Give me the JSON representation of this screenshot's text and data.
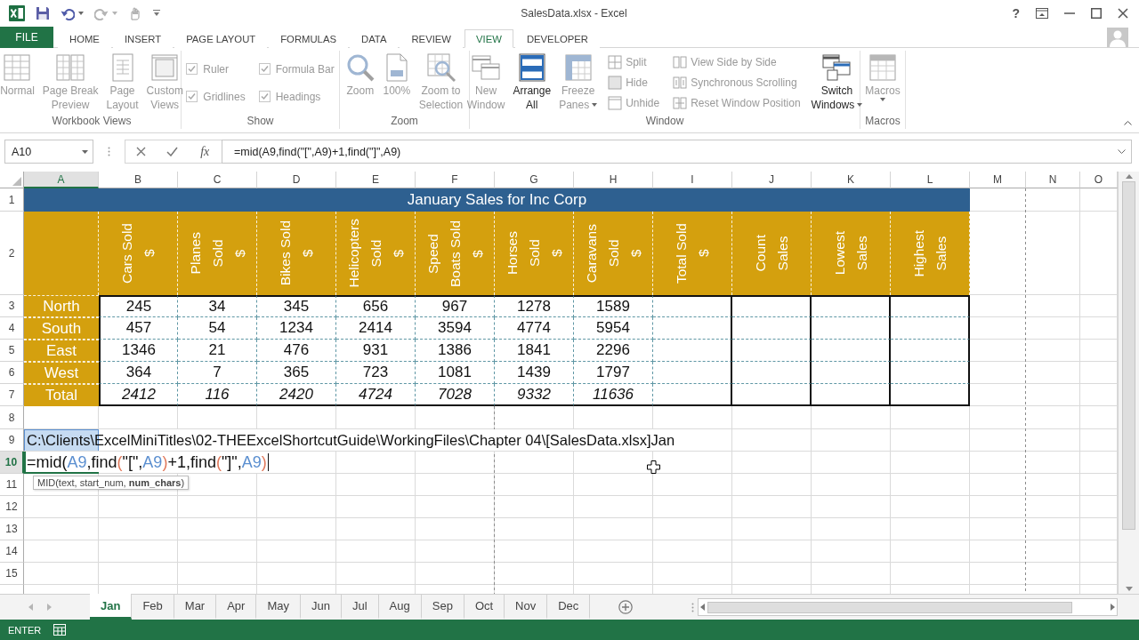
{
  "window": {
    "title": "SalesData.xlsx - Excel",
    "help": "?"
  },
  "ribbon_tabs": [
    {
      "label": "FILE",
      "kind": "file",
      "selected": false
    },
    {
      "label": "HOME",
      "kind": "tab",
      "selected": false
    },
    {
      "label": "INSERT",
      "kind": "tab",
      "selected": false
    },
    {
      "label": "PAGE LAYOUT",
      "kind": "tab",
      "selected": false
    },
    {
      "label": "FORMULAS",
      "kind": "tab",
      "selected": false
    },
    {
      "label": "DATA",
      "kind": "tab",
      "selected": false
    },
    {
      "label": "REVIEW",
      "kind": "tab",
      "selected": false
    },
    {
      "label": "VIEW",
      "kind": "tab",
      "selected": true
    },
    {
      "label": "DEVELOPER",
      "kind": "tab",
      "selected": false
    }
  ],
  "ribbon": {
    "groups": [
      {
        "title": "Workbook Views",
        "items": [
          {
            "kind": "large",
            "lines": [
              "Normal"
            ],
            "disabled": true,
            "dropdown": false
          },
          {
            "kind": "large",
            "lines": [
              "Page Break",
              "Preview"
            ],
            "disabled": true,
            "dropdown": false
          },
          {
            "kind": "large",
            "lines": [
              "Page",
              "Layout"
            ],
            "disabled": true,
            "dropdown": false
          },
          {
            "kind": "large",
            "lines": [
              "Custom",
              "Views"
            ],
            "disabled": true,
            "dropdown": false
          }
        ]
      },
      {
        "title": "Show",
        "items": [
          {
            "kind": "checkbox",
            "label": "Ruler",
            "checked": true,
            "disabled": true
          },
          {
            "kind": "checkbox",
            "label": "Gridlines",
            "checked": true,
            "disabled": true
          },
          {
            "kind": "checkbox",
            "label": "Formula Bar",
            "checked": true,
            "disabled": true
          },
          {
            "kind": "checkbox",
            "label": "Headings",
            "checked": true,
            "disabled": true
          }
        ]
      },
      {
        "title": "Zoom",
        "items": [
          {
            "kind": "large",
            "lines": [
              "Zoom"
            ],
            "disabled": true,
            "dropdown": false
          },
          {
            "kind": "large",
            "lines": [
              "100%"
            ],
            "disabled": true,
            "dropdown": false
          },
          {
            "kind": "large",
            "lines": [
              "Zoom to",
              "Selection"
            ],
            "disabled": true,
            "dropdown": false
          }
        ]
      },
      {
        "title": "Window",
        "items": [
          {
            "kind": "large",
            "lines": [
              "New",
              "Window"
            ],
            "disabled": true,
            "dropdown": false
          },
          {
            "kind": "large",
            "lines": [
              "Arrange",
              "All"
            ],
            "disabled": false,
            "dropdown": false
          },
          {
            "kind": "large",
            "lines": [
              "Freeze",
              "Panes"
            ],
            "disabled": true,
            "dropdown": true
          },
          {
            "kind": "small",
            "label": "Split",
            "disabled": true
          },
          {
            "kind": "small",
            "label": "Hide",
            "disabled": true
          },
          {
            "kind": "small",
            "label": "Unhide",
            "disabled": true
          },
          {
            "kind": "small",
            "label": "View Side by Side",
            "disabled": true
          },
          {
            "kind": "small",
            "label": "Synchronous Scrolling",
            "disabled": true
          },
          {
            "kind": "small",
            "label": "Reset Window Position",
            "disabled": true
          },
          {
            "kind": "large",
            "lines": [
              "Switch",
              "Windows"
            ],
            "disabled": false,
            "dropdown": true
          }
        ]
      },
      {
        "title": "Macros",
        "items": [
          {
            "kind": "large",
            "lines": [
              "Macros"
            ],
            "disabled": true,
            "dropdown": true
          }
        ]
      }
    ]
  },
  "formula_bar": {
    "name_box": "A10",
    "function_label": "fx",
    "formula": "=mid(A9,find(\"[\",A9)+1,find(\"]\",A9)"
  },
  "columns": [
    {
      "label": "A",
      "selected": true
    },
    {
      "label": "B",
      "selected": false
    },
    {
      "label": "C",
      "selected": false
    },
    {
      "label": "D",
      "selected": false
    },
    {
      "label": "E",
      "selected": false
    },
    {
      "label": "F",
      "selected": false
    },
    {
      "label": "G",
      "selected": false
    },
    {
      "label": "H",
      "selected": false
    },
    {
      "label": "I",
      "selected": false
    },
    {
      "label": "J",
      "selected": false
    },
    {
      "label": "K",
      "selected": false
    },
    {
      "label": "L",
      "selected": false
    },
    {
      "label": "M",
      "selected": false
    },
    {
      "label": "N",
      "selected": false
    },
    {
      "label": "O",
      "selected": false
    }
  ],
  "rows": [
    {
      "label": "1",
      "selected": false
    },
    {
      "label": "2",
      "selected": false
    },
    {
      "label": "3",
      "selected": false
    },
    {
      "label": "4",
      "selected": false
    },
    {
      "label": "5",
      "selected": false
    },
    {
      "label": "6",
      "selected": false
    },
    {
      "label": "7",
      "selected": false
    },
    {
      "label": "8",
      "selected": false
    },
    {
      "label": "9",
      "selected": false
    },
    {
      "label": "10",
      "selected": true
    },
    {
      "label": "11",
      "selected": false
    },
    {
      "label": "12",
      "selected": false
    },
    {
      "label": "13",
      "selected": false
    },
    {
      "label": "14",
      "selected": false
    },
    {
      "label": "15",
      "selected": false
    }
  ],
  "sheet": {
    "title": "January Sales for Inc Corp",
    "headers": [
      {
        "lines": [
          "Cars Sold",
          "$"
        ]
      },
      {
        "lines": [
          "Planes",
          "Sold",
          "$"
        ]
      },
      {
        "lines": [
          "Bikes Sold",
          "$"
        ]
      },
      {
        "lines": [
          "Helicopters",
          "Sold",
          "$"
        ]
      },
      {
        "lines": [
          "Speed",
          "Boats Sold",
          "$"
        ]
      },
      {
        "lines": [
          "Horses",
          "Sold",
          "$"
        ]
      },
      {
        "lines": [
          "Caravans",
          "Sold",
          "$"
        ]
      },
      {
        "lines": [
          "Total Sold",
          "$"
        ]
      },
      {
        "lines": [
          "Count",
          "Sales"
        ]
      },
      {
        "lines": [
          "Lowest",
          "Sales"
        ]
      },
      {
        "lines": [
          "Highest",
          "Sales"
        ]
      }
    ],
    "records": [
      {
        "label": "North",
        "kind": "data",
        "values": [
          "245",
          "34",
          "345",
          "656",
          "967",
          "1278",
          "1589"
        ]
      },
      {
        "label": "South",
        "kind": "data",
        "values": [
          "457",
          "54",
          "1234",
          "2414",
          "3594",
          "4774",
          "5954"
        ]
      },
      {
        "label": "East",
        "kind": "data",
        "values": [
          "1346",
          "21",
          "476",
          "931",
          "1386",
          "1841",
          "2296"
        ]
      },
      {
        "label": "West",
        "kind": "data",
        "values": [
          "364",
          "7",
          "365",
          "723",
          "1081",
          "1439",
          "1797"
        ]
      },
      {
        "label": "Total",
        "kind": "total",
        "values": [
          "2412",
          "116",
          "2420",
          "4724",
          "7028",
          "9332",
          "11636"
        ]
      }
    ],
    "path_cell": {
      "text": "C:\\Clients\\ExcelMiniTitles\\02-THEExcelShortcutGuide\\WorkingFiles\\Chapter 04\\[SalesData.xlsx]Jan",
      "reference_highlight": true
    },
    "editor": {
      "active": true,
      "segments": [
        {
          "text": "=mid(",
          "kind": "plain"
        },
        {
          "text": "A9",
          "kind": "ref"
        },
        {
          "text": ",find",
          "kind": "plain"
        },
        {
          "text": "(",
          "kind": "paren"
        },
        {
          "text": "\"[\",",
          "kind": "plain"
        },
        {
          "text": "A9",
          "kind": "ref"
        },
        {
          "text": ")",
          "kind": "paren"
        },
        {
          "text": "+1,find",
          "kind": "plain"
        },
        {
          "text": "(",
          "kind": "paren"
        },
        {
          "text": "\"]\",",
          "kind": "plain"
        },
        {
          "text": "A9",
          "kind": "ref"
        },
        {
          "text": ")",
          "kind": "paren"
        }
      ]
    },
    "tooltip": "MID(text, start_num, **num_chars**)"
  },
  "sheet_tabs": [
    {
      "label": "Jan",
      "selected": true
    },
    {
      "label": "Feb",
      "selected": false
    },
    {
      "label": "Mar",
      "selected": false
    },
    {
      "label": "Apr",
      "selected": false
    },
    {
      "label": "May",
      "selected": false
    },
    {
      "label": "Jun",
      "selected": false
    },
    {
      "label": "Jul",
      "selected": false
    },
    {
      "label": "Aug",
      "selected": false
    },
    {
      "label": "Sep",
      "selected": false
    },
    {
      "label": "Oct",
      "selected": false
    },
    {
      "label": "Nov",
      "selected": false
    },
    {
      "label": "Dec",
      "selected": false
    }
  ],
  "status_bar": {
    "mode": "ENTER"
  }
}
